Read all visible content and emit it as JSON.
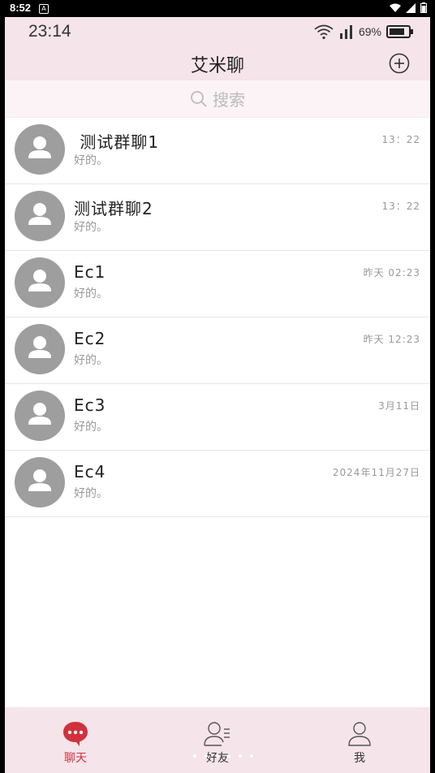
{
  "device": {
    "time": "8:52"
  },
  "status": {
    "clock": "23:14",
    "battery": "69%"
  },
  "header": {
    "title": "艾米聊"
  },
  "search": {
    "placeholder": "搜索"
  },
  "chats": [
    {
      "name": " 测试群聊1",
      "preview": "好的。",
      "time": "13：22"
    },
    {
      "name": "测试群聊2",
      "preview": "好的。",
      "time": "13：22"
    },
    {
      "name": "Ec1",
      "preview": "好的。",
      "time": "昨天 02:23"
    },
    {
      "name": "Ec2",
      "preview": "好的。",
      "time": "昨天 12:23"
    },
    {
      "name": "Ec3",
      "preview": "好的。",
      "time": "3月11日"
    },
    {
      "name": "Ec4",
      "preview": "好的。",
      "time": "2024年11月27日"
    }
  ],
  "tabs": [
    {
      "label": "聊天",
      "icon": "chat-bubble-icon",
      "active": true
    },
    {
      "label": "好友",
      "icon": "contacts-icon",
      "active": false
    },
    {
      "label": "我",
      "icon": "person-icon",
      "active": false
    }
  ],
  "colors": {
    "accent": "#d0313c",
    "header_bg": "#f5e4ea",
    "avatar": "#9e9e9e"
  }
}
